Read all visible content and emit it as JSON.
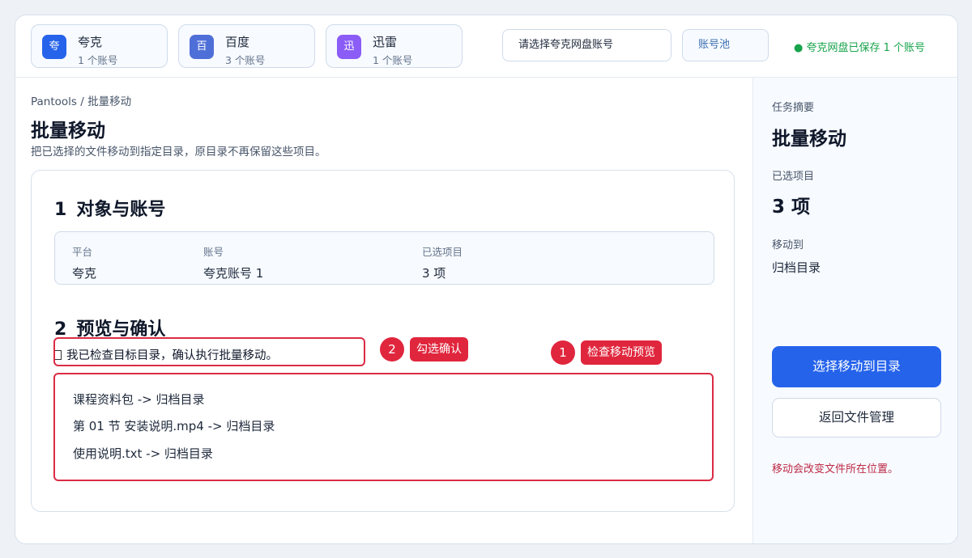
{
  "platforms": [
    {
      "icon_char": "夸",
      "name": "夸克",
      "count": "1 个账号",
      "color": "#2563eb"
    },
    {
      "icon_char": "百",
      "name": "百度",
      "count": "3 个账号",
      "color": "#4f6fd8"
    },
    {
      "icon_char": "迅",
      "name": "迅雷",
      "count": "1 个账号",
      "color": "#8b5cf6"
    }
  ],
  "account_select": {
    "placeholder": "请选择夸克网盘账号"
  },
  "pool_button": "账号池",
  "status": "● 夸克网盘已保存 1 个账号",
  "breadcrumb": "Pantools / 批量移动",
  "page_title": "批量移动",
  "page_desc": "把已选择的文件移动到指定目录，原目录不再保留这些项目。",
  "section1": {
    "num": "1",
    "title": "对象与账号",
    "fields": [
      {
        "label": "平台",
        "value": "夸克"
      },
      {
        "label": "账号",
        "value": "夸克账号 1"
      },
      {
        "label": "已选项目",
        "value": "3 项"
      }
    ]
  },
  "section2": {
    "num": "2",
    "title": "预览与确认",
    "confirm_text": "我已检查目标目录，确认执行批量移动。",
    "preview_items": [
      "课程资料包 -> 归档目录",
      "第 01 节 安装说明.mp4 -> 归档目录",
      "使用说明.txt -> 归档目录"
    ]
  },
  "annotations": [
    {
      "num": "2",
      "tag": "勾选确认"
    },
    {
      "num": "1",
      "tag": "检查移动预览"
    }
  ],
  "sidebar": {
    "summary_label": "任务摘要",
    "summary_value": "批量移动",
    "selected_label": "已选项目",
    "selected_value": "3 项",
    "moveto_label": "移动到",
    "moveto_value": "归档目录",
    "primary_button": "选择移动到目录",
    "secondary_button": "返回文件管理",
    "warning": "移动会改变文件所在位置。"
  },
  "colors": {
    "accent": "#2563eb",
    "annotation": "#e0263d",
    "success": "#16a34a",
    "warning": "#be2a45"
  }
}
